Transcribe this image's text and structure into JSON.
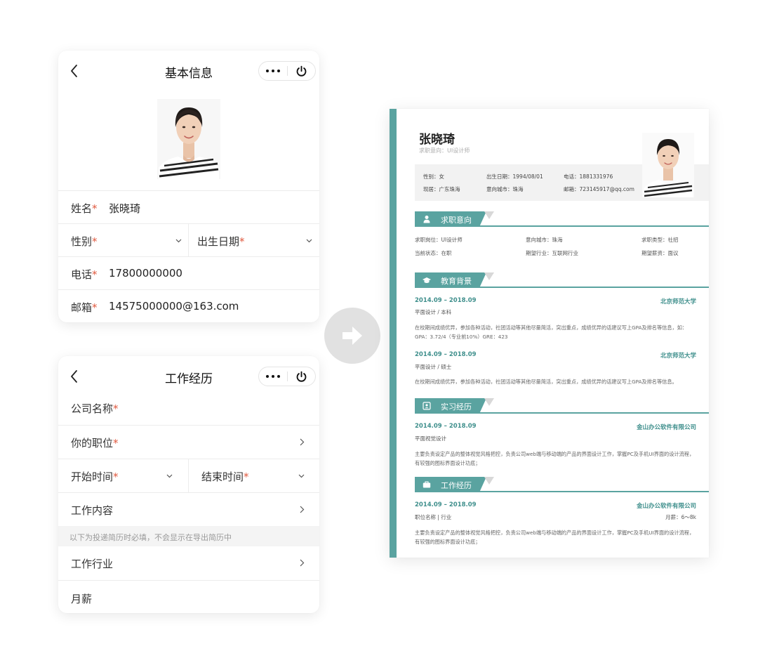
{
  "colors": {
    "accent": "#5aa3a0",
    "required": "#e0593f",
    "arrow_bg": "#e1e1e1"
  },
  "basic_card": {
    "title": "基本信息",
    "fields": {
      "name": {
        "label": "姓名",
        "value": "张晓琦"
      },
      "gender": {
        "label": "性别"
      },
      "birth": {
        "label": "出生日期"
      },
      "phone": {
        "label": "电话",
        "value": "17800000000"
      },
      "email": {
        "label": "邮箱",
        "value": "14575000000@163.com"
      }
    },
    "required_mark": "*"
  },
  "work_card": {
    "title": "工作经历",
    "company": "公司名称",
    "position": "你的职位",
    "start": "开始时间",
    "end": "结束时间",
    "content": "工作内容",
    "notice": "以下为投递简历时必填，不会显示在导出简历中",
    "industry": "工作行业",
    "salary": "月薪"
  },
  "resume": {
    "name": "张晓琦",
    "subtitle": "求职意向：UI设计师",
    "info": {
      "gender": "性别：女",
      "birth": "出生日期：1994/08/01",
      "phone": "电话：1881331976",
      "residence": "现居：广东珠海",
      "city": "意向城市：珠海",
      "email": "邮箱：723145917@qq.com"
    },
    "sections": {
      "intent": {
        "title": "求职意向",
        "position": "求职岗位：UI设计师",
        "city": "意向城市：珠海",
        "type": "求职类型：社招",
        "status": "当前状态：在职",
        "industry": "期望行业：互联网行业",
        "salary": "期望薪资：面议"
      },
      "education": {
        "title": "教育背景",
        "items": [
          {
            "date": "2014.09 – 2018.09",
            "school": "北京师范大学",
            "major": "平面设计 / 本科",
            "desc": "在校期间成绩优异，参加各种活动，社团活动等其他尽量简活，突出重点，成绩优异的话建议写上GPA及排名等信息，如：GPA：3.72/4（专业前10%）GRE：423"
          },
          {
            "date": "2014.09 – 2018.09",
            "school": "北京师范大学",
            "major": "平面设计 / 硕士",
            "desc": "在校期间成绩优异，参加各种活动，社团活动等其他尽量简活，突出重点，成绩优异的话建议写上GPA及排名等信息。"
          }
        ]
      },
      "internship": {
        "title": "实习经历",
        "date": "2014.09 – 2018.09",
        "company": "金山办公软件有限公司",
        "role": "平面视觉设计",
        "desc": "主要负责设定产品的整体视觉风格把控，负责公司web端与移动端的产品的界面设计工作，掌握PC及手机UI界面的设计流程，有较强的图标界面设计功底；"
      },
      "work": {
        "title": "工作经历",
        "date": "2014.09 – 2018.09",
        "company": "金山办公软件有限公司",
        "role": "职位名称 | 行业",
        "salary": "月薪：6～8k",
        "desc": "主要负责设定产品的整体视觉风格把控，负责公司web端与移动端的产品的界面设计工作，掌握PC及手机UI界面的设计流程，有较强的图标界面设计功底；"
      }
    }
  }
}
